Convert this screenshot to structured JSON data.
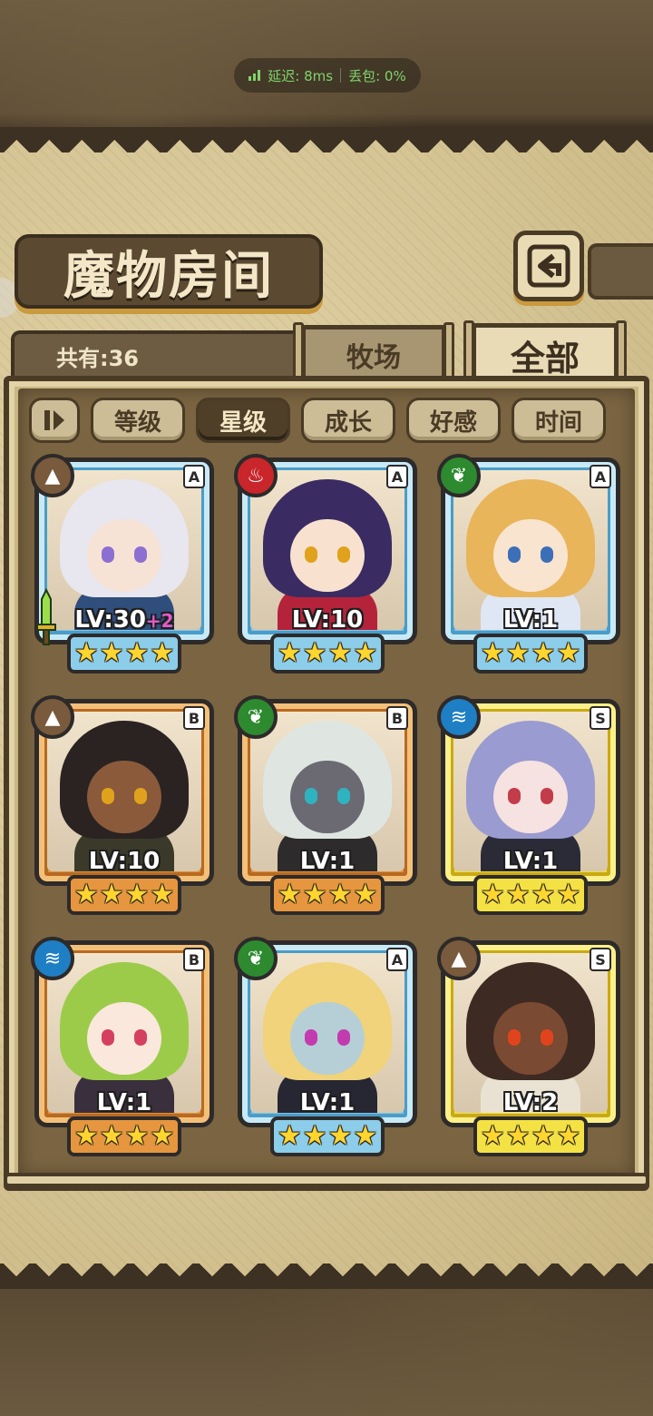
{
  "status": {
    "latency": "延迟: 8ms",
    "loss": "丢包: 0%"
  },
  "header": {
    "title": "魔物房间",
    "back_icon": "return-icon"
  },
  "count": "共有:36",
  "tabs": {
    "ranch": "牧场",
    "all": "全部",
    "active": "all"
  },
  "filters": {
    "sort_icon": "sort-toggle-icon",
    "items": [
      "等级",
      "星级",
      "成长",
      "好感",
      "时间"
    ],
    "active": "星级"
  },
  "colors": {
    "grade_A": "#7fc6e8",
    "grade_B": "#e2903a",
    "grade_S": "#f2de3a",
    "plus_level": "#e15bc7",
    "stars": "#ffd52e"
  },
  "monsters": [
    {
      "grade": "A",
      "element": "earth",
      "level": "LV:30",
      "bonus": "+2",
      "stars": 4,
      "equipped": true,
      "hair": "#e8e6ee",
      "skin": "#f7e3d6",
      "eye": "#8c6fd1",
      "outfit": "#2f4e7c"
    },
    {
      "grade": "A",
      "element": "fire",
      "level": "LV:10",
      "bonus": "",
      "stars": 4,
      "equipped": false,
      "hair": "#3a2c62",
      "skin": "#f8e2cf",
      "eye": "#e0a21c",
      "outfit": "#b5233b"
    },
    {
      "grade": "A",
      "element": "leaf",
      "level": "LV:1",
      "bonus": "",
      "stars": 4,
      "equipped": false,
      "hair": "#e9b55a",
      "skin": "#f9e4d0",
      "eye": "#3b6fb7",
      "outfit": "#dfe7f4"
    },
    {
      "grade": "B",
      "element": "earth",
      "level": "LV:10",
      "bonus": "",
      "stars": 4,
      "equipped": false,
      "hair": "#2a2321",
      "skin": "#8a5a3b",
      "eye": "#e0a21c",
      "outfit": "#3b3a2a"
    },
    {
      "grade": "B",
      "element": "leaf",
      "level": "LV:1",
      "bonus": "",
      "stars": 4,
      "equipped": false,
      "hair": "#dfe6e2",
      "skin": "#6b6a72",
      "eye": "#2fb3c0",
      "outfit": "#2d2b2c"
    },
    {
      "grade": "S",
      "element": "water",
      "level": "LV:1",
      "bonus": "",
      "stars": 4,
      "equipped": false,
      "hair": "#9a9bd0",
      "skin": "#f6e2e0",
      "eye": "#c23c4a",
      "outfit": "#2b2b38"
    },
    {
      "grade": "B",
      "element": "water",
      "level": "LV:1",
      "bonus": "",
      "stars": 4,
      "equipped": false,
      "hair": "#9ccb4a",
      "skin": "#fbe8dc",
      "eye": "#d54060",
      "outfit": "#3a2f3c"
    },
    {
      "grade": "A",
      "element": "leaf",
      "level": "LV:1",
      "bonus": "",
      "stars": 4,
      "equipped": false,
      "hair": "#f0d37a",
      "skin": "#b6cfd6",
      "eye": "#c23caf",
      "outfit": "#272633"
    },
    {
      "grade": "S",
      "element": "earth",
      "level": "LV:2",
      "bonus": "",
      "stars": 4,
      "equipped": false,
      "hair": "#3d2a22",
      "skin": "#7a4a32",
      "eye": "#e0441c",
      "outfit": "#e9e2d2"
    }
  ]
}
